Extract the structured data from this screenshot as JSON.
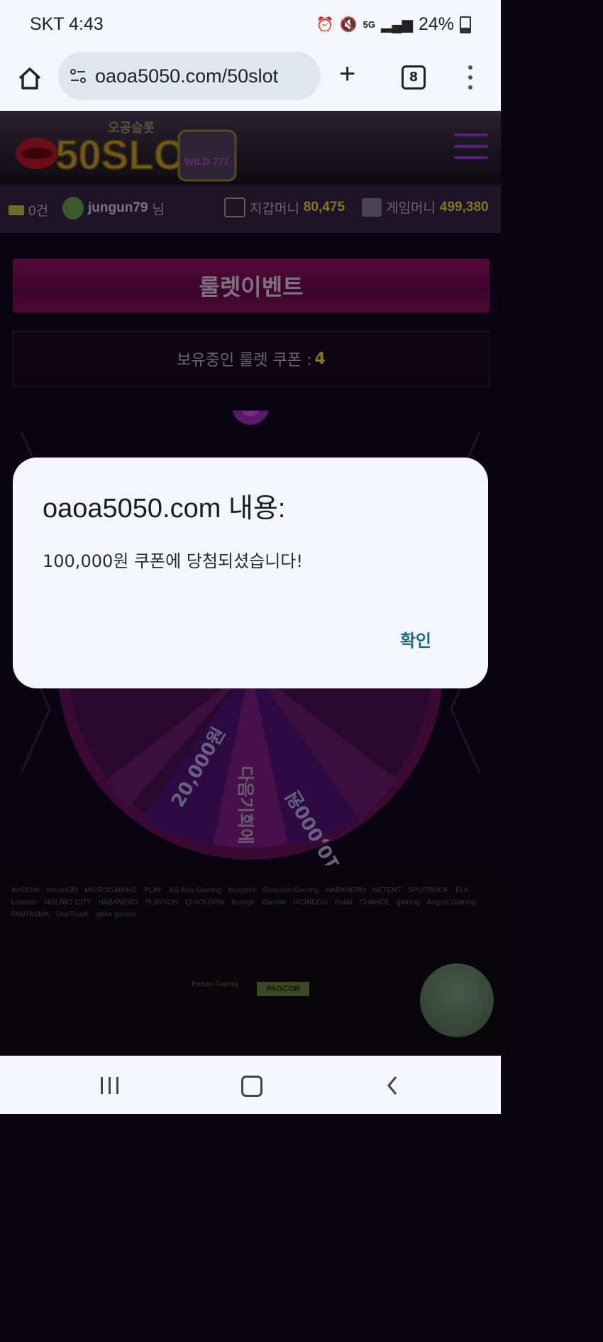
{
  "status_bar": {
    "carrier_time": "SKT 4:43",
    "network": "5G",
    "battery": "24%"
  },
  "browser": {
    "url": "oaoa5050.com/50slot",
    "tab_count": "8"
  },
  "site": {
    "logo_text": "50SLOT",
    "logo_sub": "오공슬롯",
    "logo_badge": "WILD 777",
    "messages": "0건",
    "username": "jungun79",
    "username_suffix": "님",
    "wallet_label": "지갑머니",
    "wallet_value": "80,475",
    "game_label": "게임머니",
    "game_value": "499,380",
    "event_title": "룰렛이벤트",
    "coupon_label": "보유중인 룰렛 쿠폰 :",
    "coupon_count": "4",
    "wheel_segments": [
      "20,000원",
      "다음기회에",
      "10,000원"
    ]
  },
  "footer": {
    "providers": [
      "ArrOOint",
      "dreamGO",
      "MICROGAMING",
      "PLAY",
      "AG Asia Gaming",
      "blueprint",
      "Evolution Gaming",
      "HABANERO",
      "NETENT",
      "SPLITROCK",
      "ELK",
      "Leander",
      "NOLIMIT CITY",
      "HABANERO",
      "PLAYSON",
      "QUICKSPIN",
      "bcongo",
      "Gamble",
      "IRONDOG",
      "Rakki",
      "CHANCE",
      "gaming",
      "August Gaming",
      "FANTASMA",
      "OneTouch",
      "spike games"
    ],
    "fortune": "Fortune Gaming",
    "pagcor": "PAGCOR"
  },
  "dialog": {
    "title": "oaoa5050.com 내용:",
    "message": "100,000원 쿠폰에 당첨되셨습니다!",
    "ok_label": "확인"
  },
  "colors": {
    "accent_gold": "#8a7420",
    "dialog_button": "#1f6a80",
    "event_button": "#5a0a3e"
  }
}
